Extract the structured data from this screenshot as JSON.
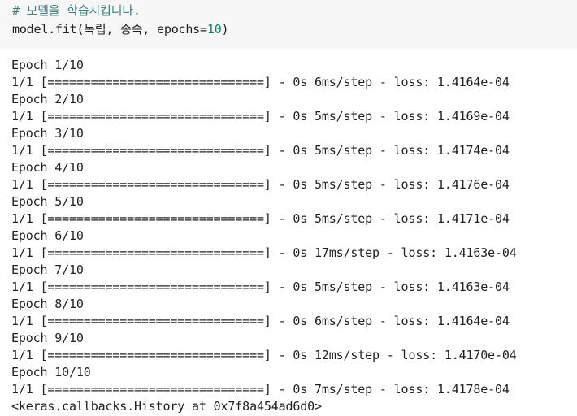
{
  "code_cell": {
    "comment": "# 모델을 학습시킵니다.",
    "code_prefix": "model.fit(독립, 종속, epochs=",
    "code_number": "10",
    "code_suffix": ")"
  },
  "output_lines": [
    "Epoch 1/10",
    "1/1 [==============================] - 0s 6ms/step - loss: 1.4164e-04",
    "Epoch 2/10",
    "1/1 [==============================] - 0s 5ms/step - loss: 1.4169e-04",
    "Epoch 3/10",
    "1/1 [==============================] - 0s 5ms/step - loss: 1.4174e-04",
    "Epoch 4/10",
    "1/1 [==============================] - 0s 5ms/step - loss: 1.4176e-04",
    "Epoch 5/10",
    "1/1 [==============================] - 0s 5ms/step - loss: 1.4171e-04",
    "Epoch 6/10",
    "1/1 [==============================] - 0s 17ms/step - loss: 1.4163e-04",
    "Epoch 7/10",
    "1/1 [==============================] - 0s 5ms/step - loss: 1.4163e-04",
    "Epoch 8/10",
    "1/1 [==============================] - 0s 6ms/step - loss: 1.4164e-04",
    "Epoch 9/10",
    "1/1 [==============================] - 0s 12ms/step - loss: 1.4170e-04",
    "Epoch 10/10",
    "1/1 [==============================] - 0s 7ms/step - loss: 1.4178e-04"
  ],
  "result_text": "<keras.callbacks.History at 0x7f8a454ad6d0>",
  "colors": {
    "cell_background": "#f7f7f7",
    "comment": "#408080",
    "number": "#098658",
    "text": "#212121"
  }
}
